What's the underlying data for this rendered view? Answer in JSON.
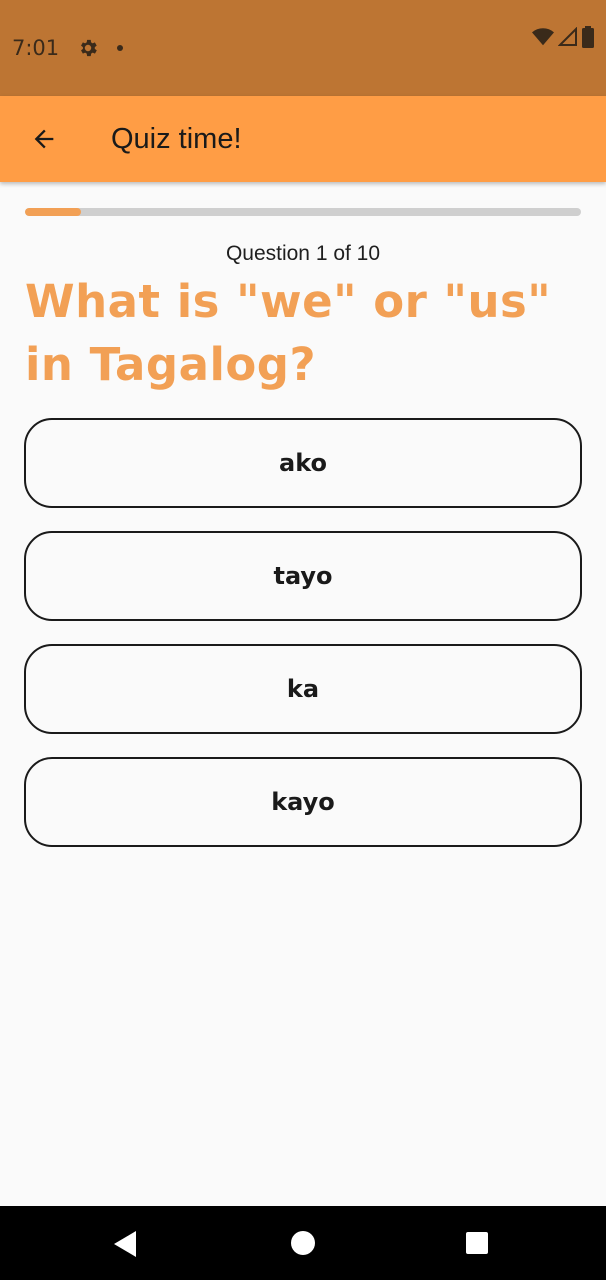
{
  "status_bar": {
    "time": "7:01"
  },
  "app_bar": {
    "title": "Quiz time!"
  },
  "progress": {
    "fraction": 0.1
  },
  "quiz": {
    "counter": "Question 1 of 10",
    "question": "What is \"we\" or \"us\" in Tagalog?",
    "options": [
      "ako",
      "tayo",
      "ka",
      "kayo"
    ]
  },
  "colors": {
    "status_bar": "#bd7533",
    "app_bar": "#ff9d45",
    "accent": "#f2a055"
  },
  "icons": {
    "back": "arrow-left-icon",
    "settings": "gear-icon",
    "wifi": "wifi-icon",
    "signal": "signal-icon",
    "battery": "battery-icon"
  }
}
